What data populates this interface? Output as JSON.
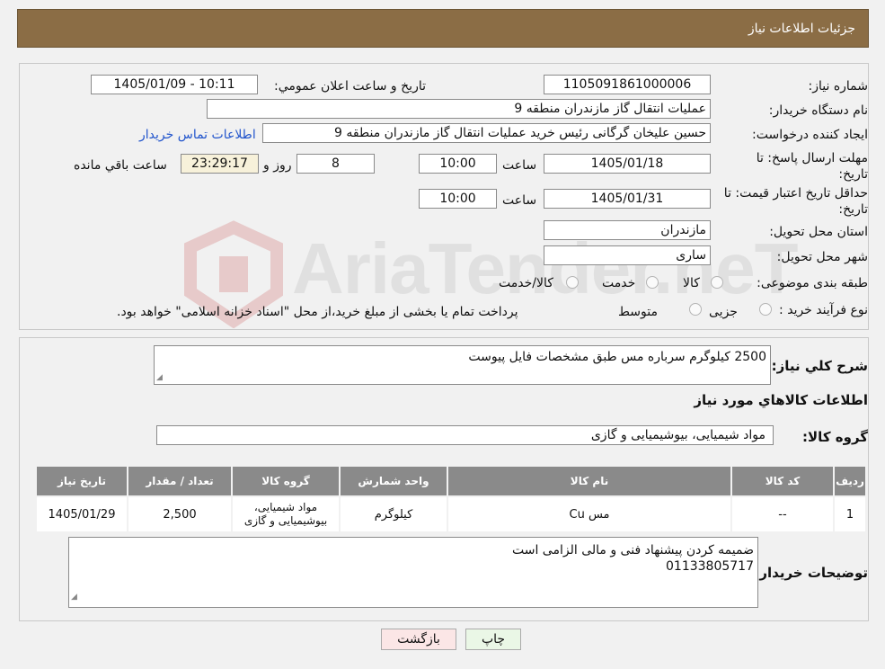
{
  "header": {
    "title": "جزئیات اطلاعات نیاز"
  },
  "watermark": {
    "text": "AriaTender.neT"
  },
  "form": {
    "need_number_label": "شماره نیاز:",
    "need_number": "1105091861000006",
    "announce_label": "تاریخ و ساعت اعلان عمومي:",
    "announce_value": "1405/01/09 - 10:11",
    "buyer_org_label": "نام دستگاه خريدار:",
    "buyer_org": "عملیات انتقال گاز مازندران منطقه 9",
    "creator_label": "ايجاد کننده درخواست:",
    "creator": "حسین علیخان گرگانی رئیس خرید عملیات انتقال گاز مازندران منطقه 9",
    "contact_link": "اطلاعات تماس خريدار",
    "deadline_label": "مهلت ارسال پاسخ: تا تاريخ:",
    "deadline_date": "1405/01/18",
    "time_label": "ساعت",
    "deadline_time": "10:00",
    "days": "8",
    "days_label": "روز و",
    "remaining_time": "23:29:17",
    "remaining_label": "ساعت باقي مانده",
    "price_validity_label": "حداقل تاريخ اعتبار قيمت: تا تاريخ:",
    "price_validity_date": "1405/01/31",
    "price_validity_time": "10:00",
    "province_label": "استان محل تحويل:",
    "province": "مازندران",
    "city_label": "شهر محل تحويل:",
    "city": "ساری",
    "category_label": "طبقه بندی موضوعی:",
    "category_options": [
      "کالا",
      "خدمت",
      "کالا/خدمت"
    ],
    "process_label": "نوع فرآيند خريد :",
    "process_options": [
      "جزیی",
      "متوسط"
    ],
    "process_note": "پرداخت تمام يا بخشی از مبلغ خريد،از محل \"اسناد خزانه اسلامی\" خواهد بود."
  },
  "summary": {
    "desc_label": "شرح کلي نياز:",
    "desc": "2500 کیلوگرم سرباره مس طبق مشخصات فایل پیوست",
    "items_heading": "اطلاعات کالاهاي مورد نياز",
    "group_label": "گروه کالا:",
    "group": "مواد شیمیایی، بیوشیمیایی و  گازی",
    "table": {
      "headers": [
        "رديف",
        "کد کالا",
        "نام کالا",
        "واحد شمارش",
        "گروه کالا",
        "تعداد / مقدار",
        "تاريخ نياز"
      ],
      "rows": [
        [
          "1",
          "--",
          "مس Cu",
          "کیلوگرم",
          "مواد شیمیایی، بیوشیمیایی و گازی",
          "2,500",
          "1405/01/29"
        ]
      ]
    },
    "buyer_notes_label": "توضيحات خريدار:",
    "buyer_notes_line1": "ضمیمه کردن پیشنهاد فنی و مالی الزامی است",
    "buyer_notes_line2": "01133805717"
  },
  "buttons": {
    "print": "چاپ",
    "back": "بازگشت"
  }
}
